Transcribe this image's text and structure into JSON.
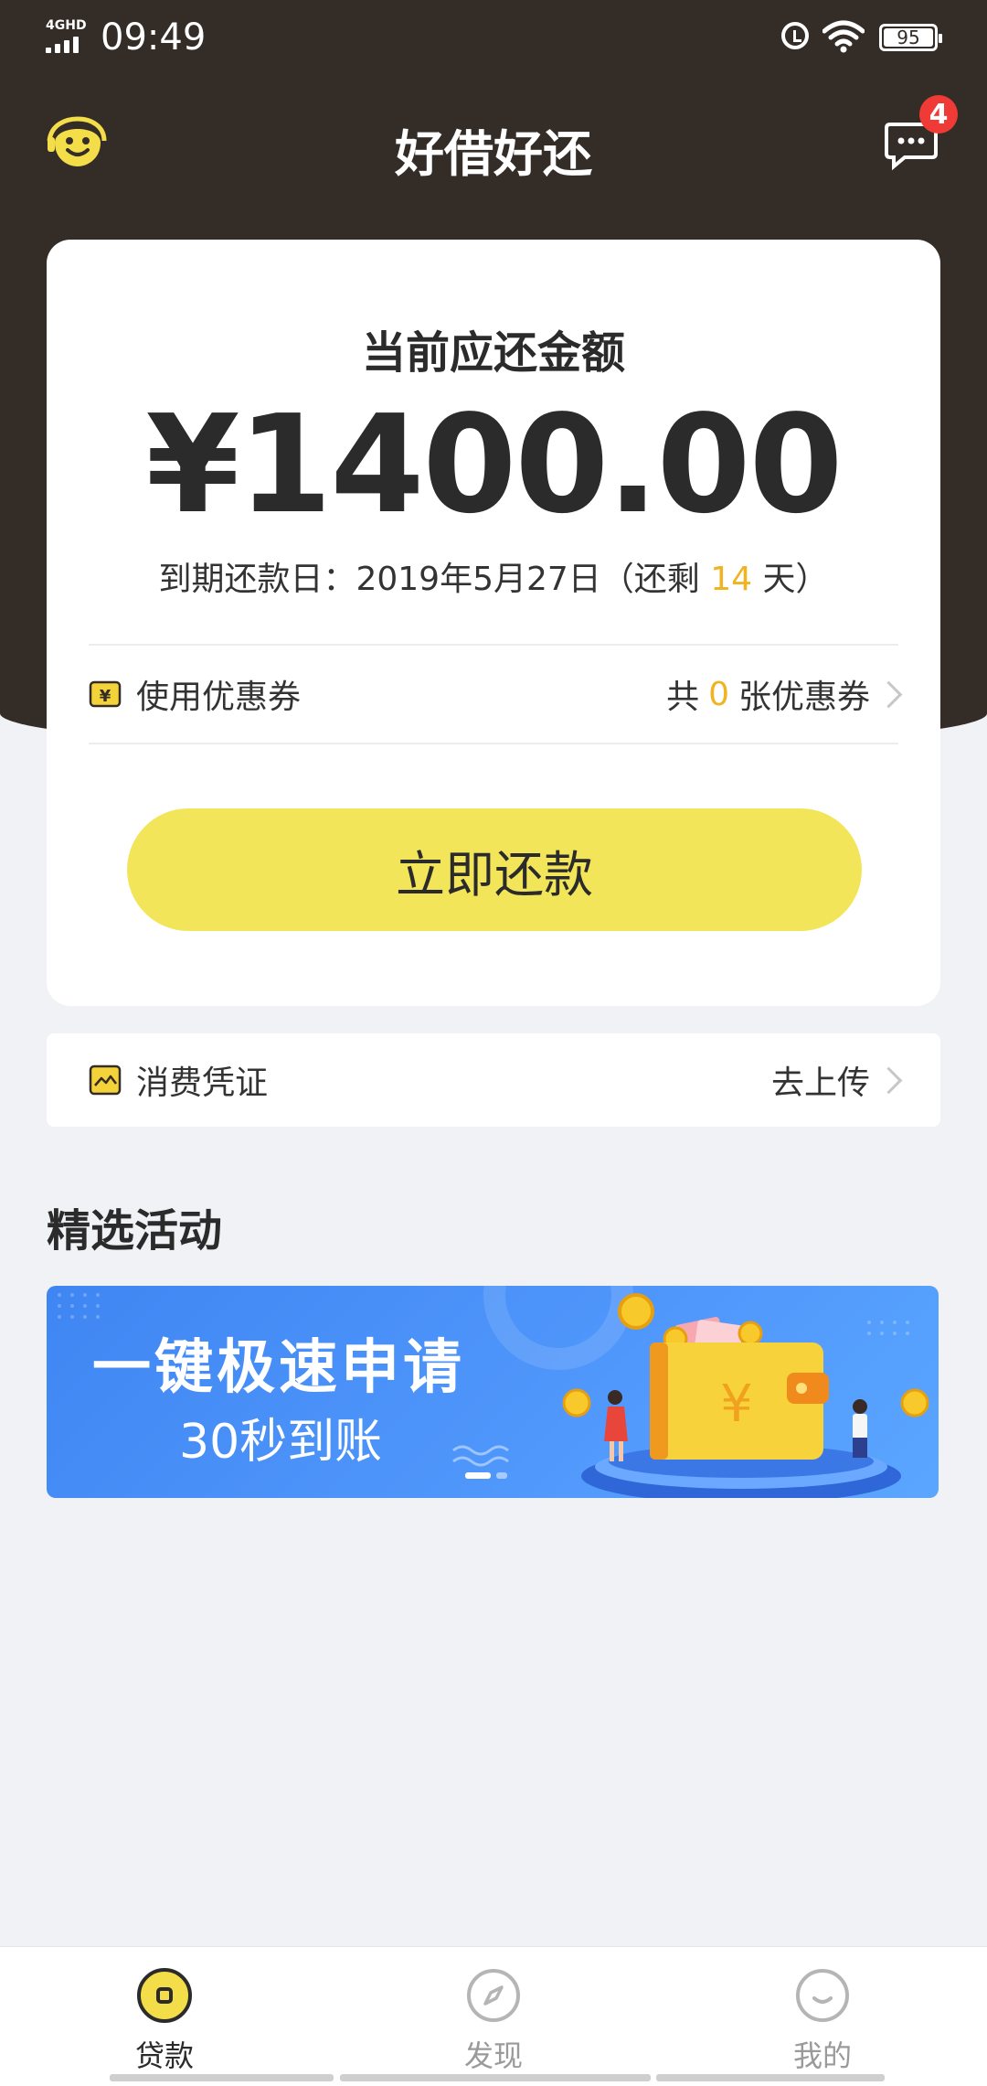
{
  "status_bar": {
    "network": "4GHD",
    "time": "09:49",
    "battery": "95"
  },
  "header": {
    "title": "好借好还",
    "message_badge": "4"
  },
  "repay_card": {
    "label": "当前应还金额",
    "amount": "¥1400.00",
    "due_prefix": "到期还款日：2019年5月27日（还剩",
    "due_days": "14",
    "due_suffix": "天）",
    "coupon_label": "使用优惠券",
    "coupon_prefix": "共",
    "coupon_count": "0",
    "coupon_suffix": "张优惠券",
    "button_label": "立即还款"
  },
  "voucher": {
    "label": "消费凭证",
    "action": "去上传"
  },
  "section": {
    "title": "精选活动"
  },
  "banner": {
    "title": "一键极速申请",
    "subtitle": "30秒到账",
    "wallet_symbol": "¥"
  },
  "nav": {
    "items": [
      {
        "label": "贷款",
        "active": true
      },
      {
        "label": "发现",
        "active": false
      },
      {
        "label": "我的",
        "active": false
      }
    ]
  },
  "colors": {
    "header_bg": "#342c27",
    "accent_yellow": "#f3e55a",
    "highlight": "#f2b320",
    "banner_blue": "#4f96fb",
    "badge_red": "#f03a35"
  }
}
